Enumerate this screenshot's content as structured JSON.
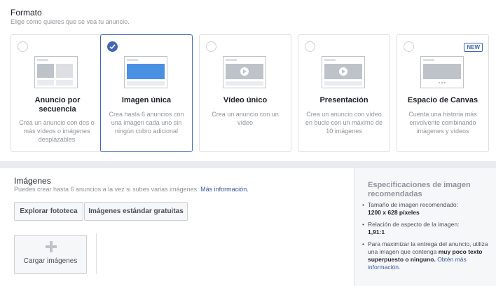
{
  "formato": {
    "title": "Formato",
    "subtitle": "Elige cómo quieres que se vea tu anuncio.",
    "cards": [
      {
        "title": "Anuncio por secuencia",
        "desc": "Crea un anuncio con dos o más vídeos o imágenes desplazables",
        "selected": false,
        "icon": "carousel-thumbnail-icon"
      },
      {
        "title": "Imagen única",
        "desc": "Crea hasta 6 anuncios con una imagen cada uno sin ningún cobro adicional",
        "selected": true,
        "icon": "single-image-thumbnail-icon"
      },
      {
        "title": "Vídeo único",
        "desc": "Crea un anuncio con un vídeo",
        "selected": false,
        "icon": "video-thumbnail-icon"
      },
      {
        "title": "Presentación",
        "desc": "Crea un anuncio con vídeo en bucle con un máximo de 10 imágenes",
        "selected": false,
        "icon": "slideshow-thumbnail-icon"
      },
      {
        "title": "Espacio de Canvas",
        "desc": "Cuenta una historia más envolvente combinando imágenes y vídeos",
        "selected": false,
        "badge": "NEW",
        "icon": "canvas-thumbnail-icon"
      }
    ]
  },
  "imagenes": {
    "title": "Imágenes",
    "subtitle": "Puedes crear hasta 6 anuncios a la vez si subes varias imágenes.",
    "more_link": "Más información.",
    "browse_button": "Explorar fototeca",
    "stock_button": "Imágenes estándar gratuitas",
    "upload_label": "Cargar imágenes"
  },
  "specs": {
    "title": "Especificaciones de imagen recomendadas",
    "size_label": "Tamaño de imagen recomendado:",
    "size_value": "1200 x 628 píxeles",
    "ratio_label": "Relación de aspecto de la imagen:",
    "ratio_value": "1,91:1",
    "tip_text": "Para maximizar la entrega del anuncio, utiliza una imagen que contenga",
    "tip_bold": "muy poco texto superpuesto o ninguno.",
    "tip_link": "Obtén más información."
  },
  "colors": {
    "accent": "#4267b2",
    "link": "#365899",
    "muted": "#90949c"
  }
}
